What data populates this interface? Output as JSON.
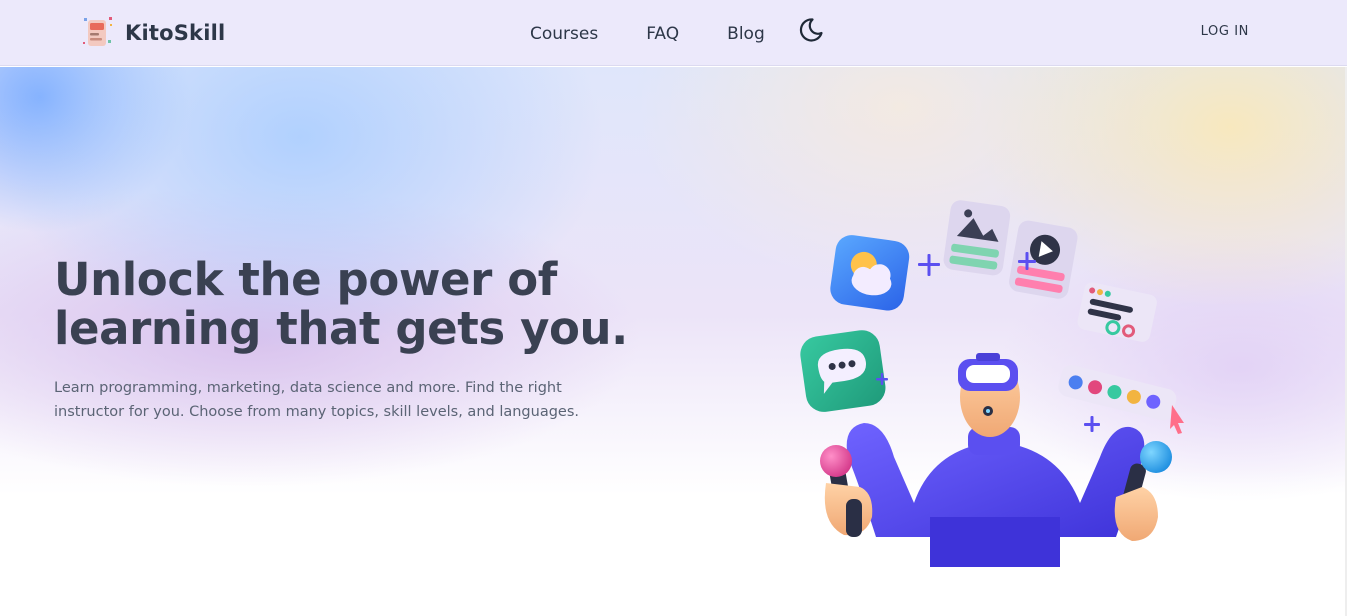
{
  "brand": {
    "name": "KitoSkill",
    "logo_icon": "book-stack-logo"
  },
  "nav": {
    "links": [
      {
        "label": "Courses"
      },
      {
        "label": "FAQ"
      },
      {
        "label": "Blog"
      }
    ],
    "theme_toggle_icon": "moon-icon",
    "login_label": "LOG IN"
  },
  "hero": {
    "headline_line1": "Unlock the power of",
    "headline_line2": "learning that gets you.",
    "subtext_line1": "Learn programming, marketing, data science and more. Find the right",
    "subtext_line2": "instructor for you. Choose from many topics, skill levels, and languages.",
    "illustration": "vr-learner-illustration"
  },
  "colors": {
    "navbar_bg": "#ece9fb",
    "heading": "#3a4152",
    "body_text": "#5b6475",
    "accent_purple": "#5b4ff0"
  }
}
